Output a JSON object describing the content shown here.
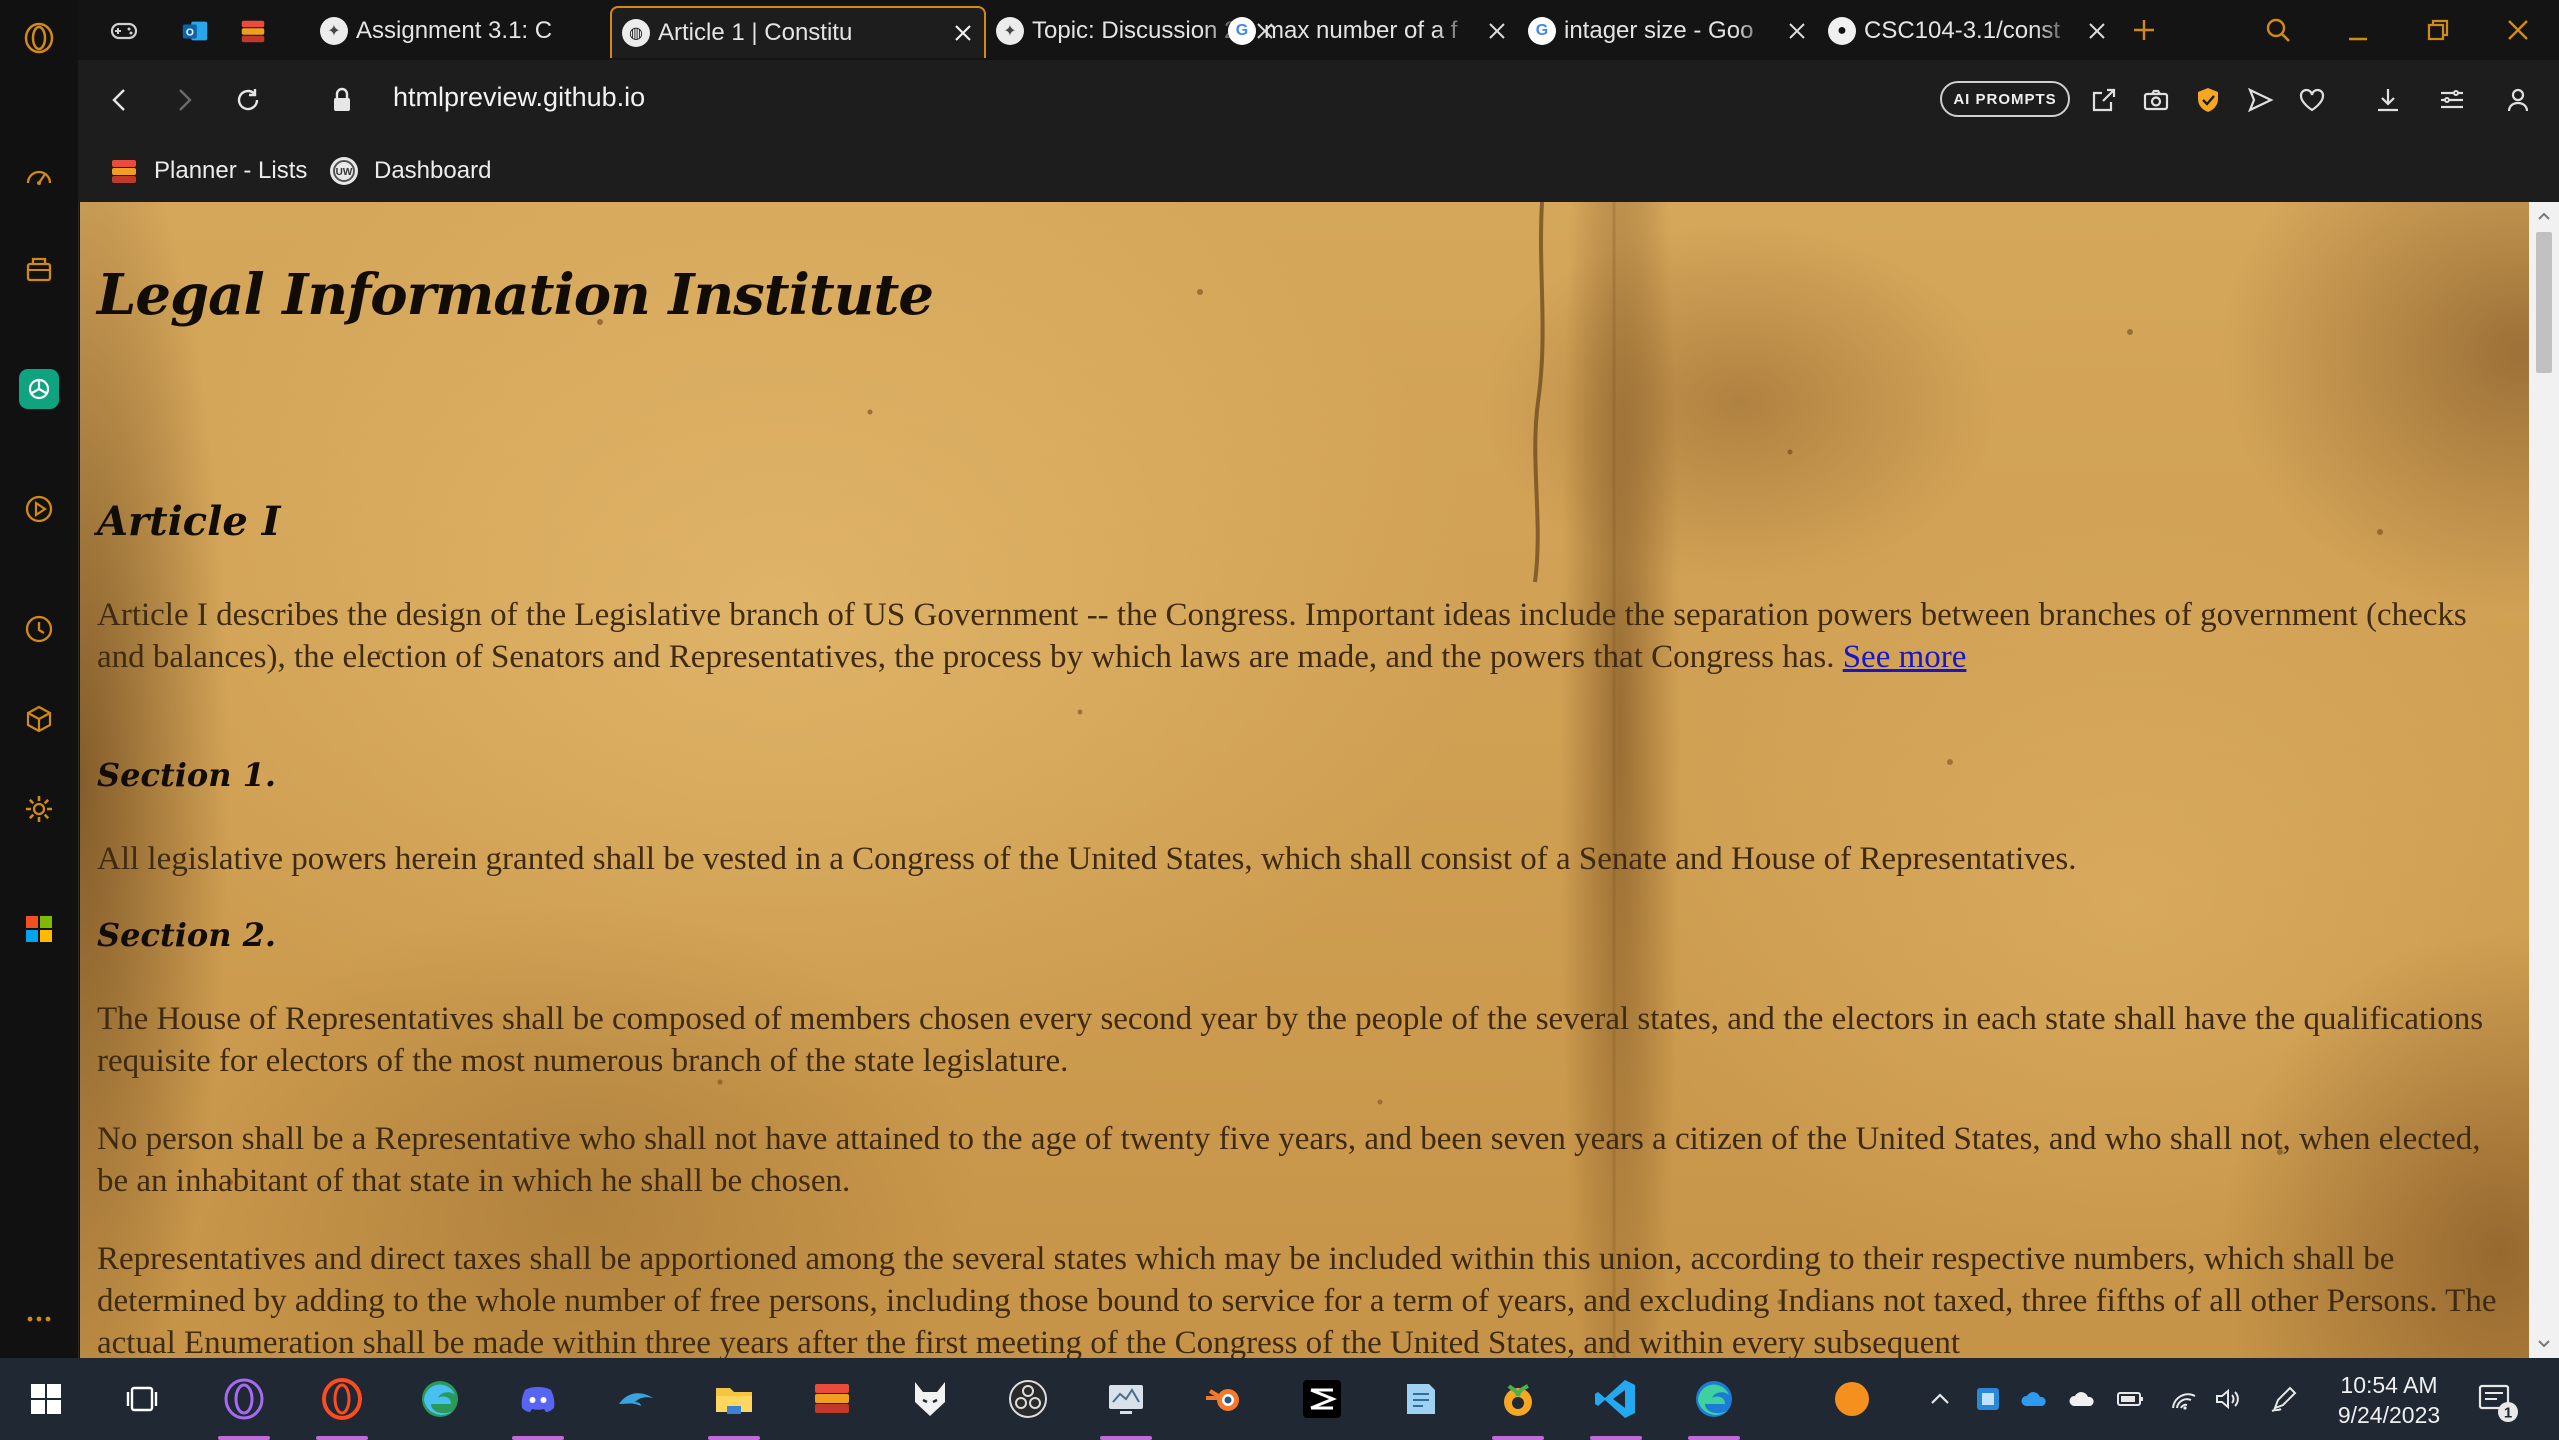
{
  "browser": {
    "tabs": [
      {
        "title": "Assignment 3.1: C",
        "favicon": "umd-seal-icon",
        "active": false
      },
      {
        "title": "Article 1 | Constitu",
        "favicon": "globe-icon",
        "active": true
      },
      {
        "title": "Topic: Discussion 2",
        "favicon": "umd-seal-icon",
        "active": false
      },
      {
        "title": "max number of a f",
        "favicon": "google-icon",
        "active": false
      },
      {
        "title": "intager size - Goo",
        "favicon": "google-icon",
        "active": false
      },
      {
        "title": "CSC104-3.1/const",
        "favicon": "github-icon",
        "active": false
      }
    ],
    "url": "htmlpreview.github.io",
    "ai_prompts_label": "AI PROMPTS",
    "bookmarks": [
      {
        "label": "Planner - Lists",
        "icon": "planner-icon"
      },
      {
        "label": "Dashboard",
        "icon": "umd-seal-icon"
      }
    ]
  },
  "page": {
    "site_title": "Legal Information Institute",
    "article_heading": "Article I",
    "intro_text": "Article I describes the design of the Legislative branch of US Government -- the Congress. Important ideas include the separation powers between branches of government (checks and balances), the election of Senators and Representatives, the process by which laws are made, and the powers that Congress has.",
    "see_more_label": "See more",
    "section1_heading": "Section 1.",
    "section1_text": "All legislative powers herein granted shall be vested in a Congress of the United States, which shall consist of a Senate and House of Representatives.",
    "section2_heading": "Section 2.",
    "section2_p1": "The House of Representatives shall be composed of members chosen every second year by the people of the several states, and the electors in each state shall have the qualifications requisite for electors of the most numerous branch of the state legislature.",
    "section2_p2": "No person shall be a Representative who shall not have attained to the age of twenty five years, and been seven years a citizen of the United States, and who shall not, when elected, be an inhabitant of that state in which he shall be chosen.",
    "section2_p3": "Representatives and direct taxes shall be apportioned among the several states which may be included within this union, according to their respective numbers, which shall be determined by adding to the whole number of free persons, including those bound to service for a term of years, and excluding Indians not taxed, three fifths of all other Persons. The actual Enumeration shall be made within three years after the first meeting of the Congress of the United States, and within every subsequent"
  },
  "scroll_position_fraction": 0.0,
  "taskbar": {
    "apps": [
      "windows-start-icon",
      "task-view-icon",
      "opera-gx-icon",
      "opera-icon",
      "edge-beta-icon",
      "discord-icon",
      "dolphin-icon",
      "file-explorer-icon",
      "planner-icon",
      "fox-icon",
      "obs-icon",
      "monitor-app-icon",
      "blender-icon",
      "capcut-icon",
      "notepad-icon",
      "fl-studio-icon",
      "vscode-icon",
      "edge-icon",
      "orange-circle-icon"
    ],
    "time": "10:54 AM",
    "date": "9/24/2023",
    "notification_count": "1"
  },
  "colors": {
    "tab_accent": "#d28a14",
    "link": "#1a16c8",
    "chatgpt": "#10a37f",
    "running_indicator": "#c06bd8",
    "vpn_badge": "#f5a623"
  }
}
